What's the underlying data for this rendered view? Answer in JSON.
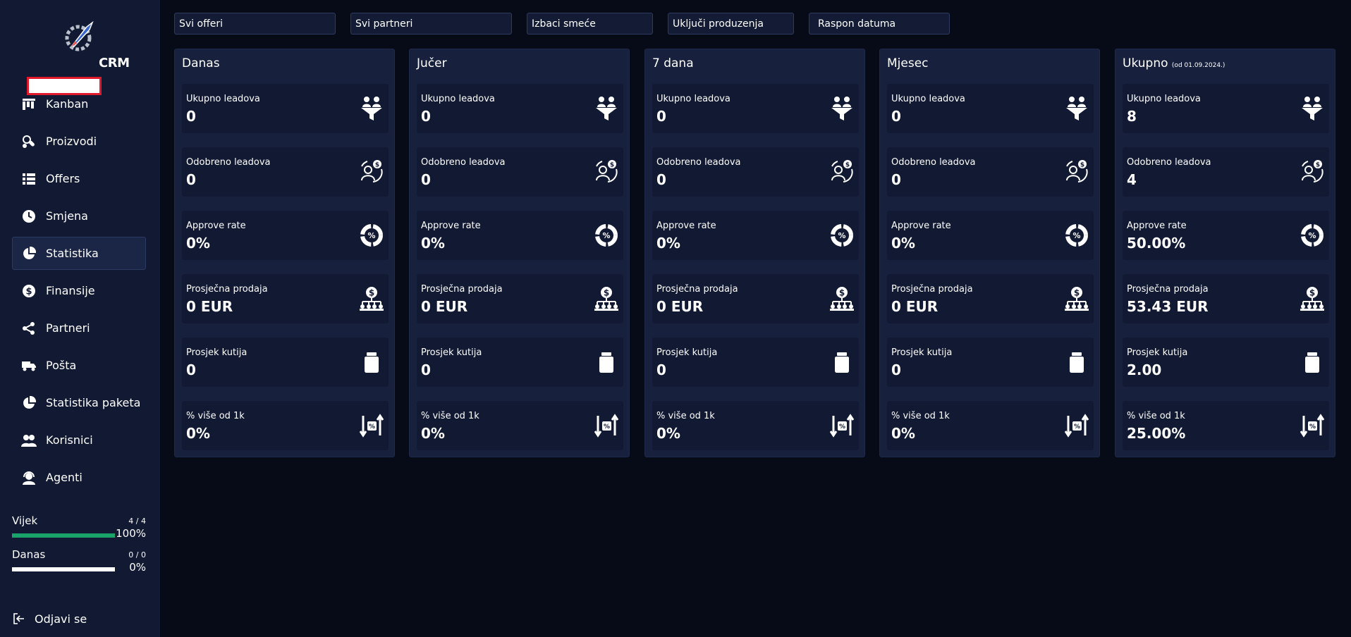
{
  "sidebar": {
    "brand": "CRM",
    "items": [
      {
        "label": "Kanban",
        "icon": "kanban-icon"
      },
      {
        "label": "Proizvodi",
        "icon": "products-icon"
      },
      {
        "label": "Offers",
        "icon": "list-icon"
      },
      {
        "label": "Smjena",
        "icon": "clock-icon"
      },
      {
        "label": "Statistika",
        "icon": "pie-chart-icon",
        "active": true
      },
      {
        "label": "Finansije",
        "icon": "dollar-icon"
      },
      {
        "label": "Partneri",
        "icon": "share-icon"
      },
      {
        "label": "Pošta",
        "icon": "truck-icon"
      },
      {
        "label": "Statistika paketa",
        "icon": "pie-chart-icon"
      },
      {
        "label": "Korisnici",
        "icon": "users-icon"
      },
      {
        "label": "Agenti",
        "icon": "agent-icon"
      }
    ],
    "progress": [
      {
        "label": "Vijek",
        "count": "4 / 4",
        "percent": "100%",
        "fill": 1.0
      },
      {
        "label": "Danas",
        "count": "0 / 0",
        "percent": "0%",
        "fill": 0.0
      }
    ],
    "logout": "Odjavi se"
  },
  "filters": [
    "Svi offeri",
    "Svi partneri",
    "Izbaci smeće",
    "Uključi produzenja",
    "Raspon datuma"
  ],
  "columns": [
    {
      "title": "Danas",
      "subtitle": "",
      "values": [
        "0",
        "0",
        "0%",
        "0 EUR",
        "0",
        "0%"
      ]
    },
    {
      "title": "Jučer",
      "subtitle": "",
      "values": [
        "0",
        "0",
        "0%",
        "0 EUR",
        "0",
        "0%"
      ]
    },
    {
      "title": "7 dana",
      "subtitle": "",
      "values": [
        "0",
        "0",
        "0%",
        "0 EUR",
        "0",
        "0%"
      ]
    },
    {
      "title": "Mjesec",
      "subtitle": "",
      "values": [
        "0",
        "0",
        "0%",
        "0 EUR",
        "0",
        "0%"
      ]
    },
    {
      "title": "Ukupno",
      "subtitle": "(od 01.09.2024.)",
      "values": [
        "8",
        "4",
        "50.00%",
        "53.43 EUR",
        "2.00",
        "25.00%"
      ]
    }
  ],
  "metrics": [
    {
      "label": "Ukupno leadova",
      "icon": "funnel-users-icon"
    },
    {
      "label": "Odobreno leadova",
      "icon": "user-dollar-icon"
    },
    {
      "label": "Approve rate",
      "icon": "percent-donut-icon"
    },
    {
      "label": "Prosječna prodaja",
      "icon": "dollar-hierarchy-icon"
    },
    {
      "label": "Prosjek kutija",
      "icon": "jar-icon"
    },
    {
      "label": "% više od 1k",
      "icon": "percent-arrows-icon"
    }
  ]
}
